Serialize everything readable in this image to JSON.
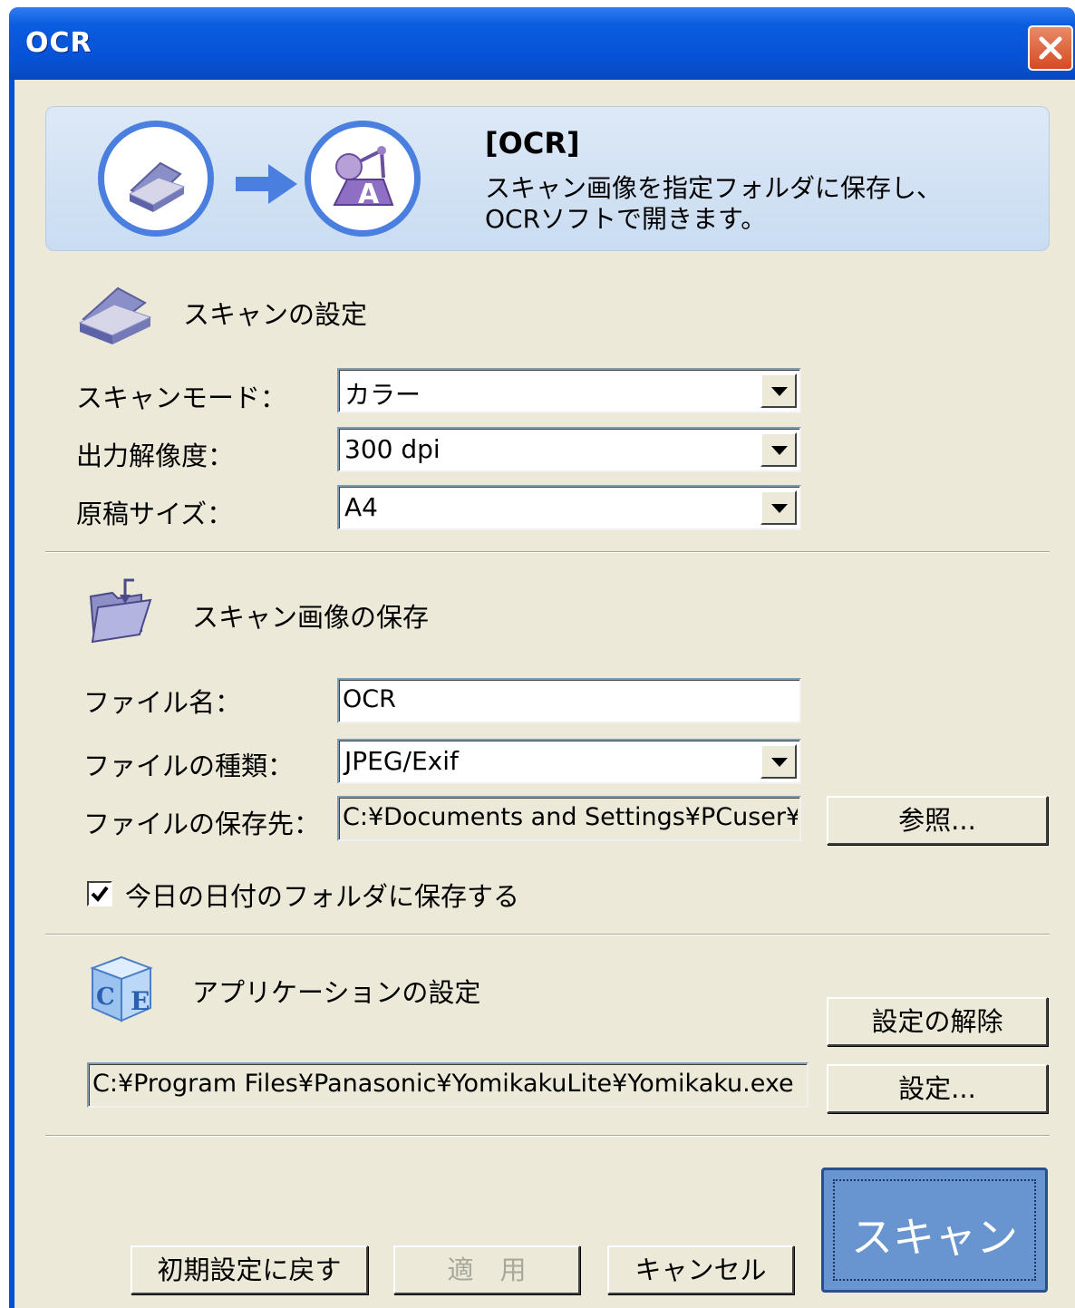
{
  "window": {
    "title": "OCR"
  },
  "banner": {
    "title": "[OCR]",
    "description_line1": "スキャン画像を指定フォルダに保存し、",
    "description_line2": "OCRソフトで開きます。"
  },
  "scan_settings": {
    "heading": "スキャンの設定",
    "mode_label": "スキャンモード：",
    "mode_value": "カラー",
    "resolution_label": "出力解像度：",
    "resolution_value": "300 dpi",
    "size_label": "原稿サイズ：",
    "size_value": "A4"
  },
  "save_settings": {
    "heading": "スキャン画像の保存",
    "filename_label": "ファイル名：",
    "filename_value": "OCR",
    "filetype_label": "ファイルの種類：",
    "filetype_value": "JPEG/Exif",
    "destination_label": "ファイルの保存先：",
    "destination_value": "C:¥Documents and Settings¥PCuser¥",
    "browse_label": "参照...",
    "date_folder_label": "今日の日付のフォルダに保存する",
    "date_folder_checked": true
  },
  "app_settings": {
    "heading": "アプリケーションの設定",
    "clear_label": "設定の解除",
    "path_value": "C:¥Program Files¥Panasonic¥YomikakuLite¥Yomikaku.exe",
    "set_label": "設定..."
  },
  "footer": {
    "reset_label": "初期設定に戻す",
    "apply_label": "適　用",
    "cancel_label": "キャンセル",
    "scan_label": "スキャン"
  },
  "colors": {
    "titlebar": "#0752d6",
    "dialog_bg": "#ece9d8",
    "banner_bg": "#c9dcf1",
    "accent_blue": "#4a7fe0",
    "scan_button": "#6895cf"
  }
}
